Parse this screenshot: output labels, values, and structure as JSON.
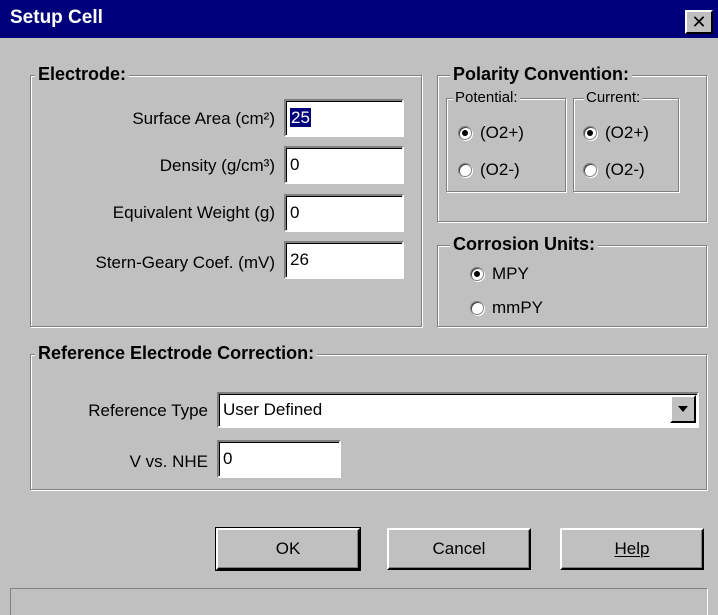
{
  "dialog": {
    "title": "Setup Cell"
  },
  "electrode": {
    "legend": "Electrode:",
    "surface_area": {
      "label": "Surface Area (cm²)",
      "value": "25"
    },
    "density": {
      "label": "Density (g/cm³)",
      "value": "0"
    },
    "equivalent_weight": {
      "label": "Equivalent Weight (g)",
      "value": "0"
    },
    "stern_geary": {
      "label": "Stern-Geary Coef. (mV)",
      "value": "26"
    }
  },
  "polarity": {
    "legend": "Polarity Convention:",
    "potential": {
      "legend": "Potential:",
      "options": [
        "(O2+)",
        "(O2-)"
      ],
      "selected": "(O2+)"
    },
    "current": {
      "legend": "Current:",
      "options": [
        "(O2+)",
        "(O2-)"
      ],
      "selected": "(O2+)"
    }
  },
  "corrosion_units": {
    "legend": "Corrosion Units:",
    "options": [
      "MPY",
      "mmPY"
    ],
    "selected": "MPY"
  },
  "reference": {
    "legend": "Reference Electrode Correction:",
    "type_label": "Reference Type",
    "type_value": "User Defined",
    "nhe_label": "V vs. NHE",
    "nhe_value": "0"
  },
  "buttons": {
    "ok": "OK",
    "cancel": "Cancel",
    "help": "Help"
  },
  "icons": {
    "close": "close-icon",
    "dropdown": "chevron-down-icon"
  }
}
